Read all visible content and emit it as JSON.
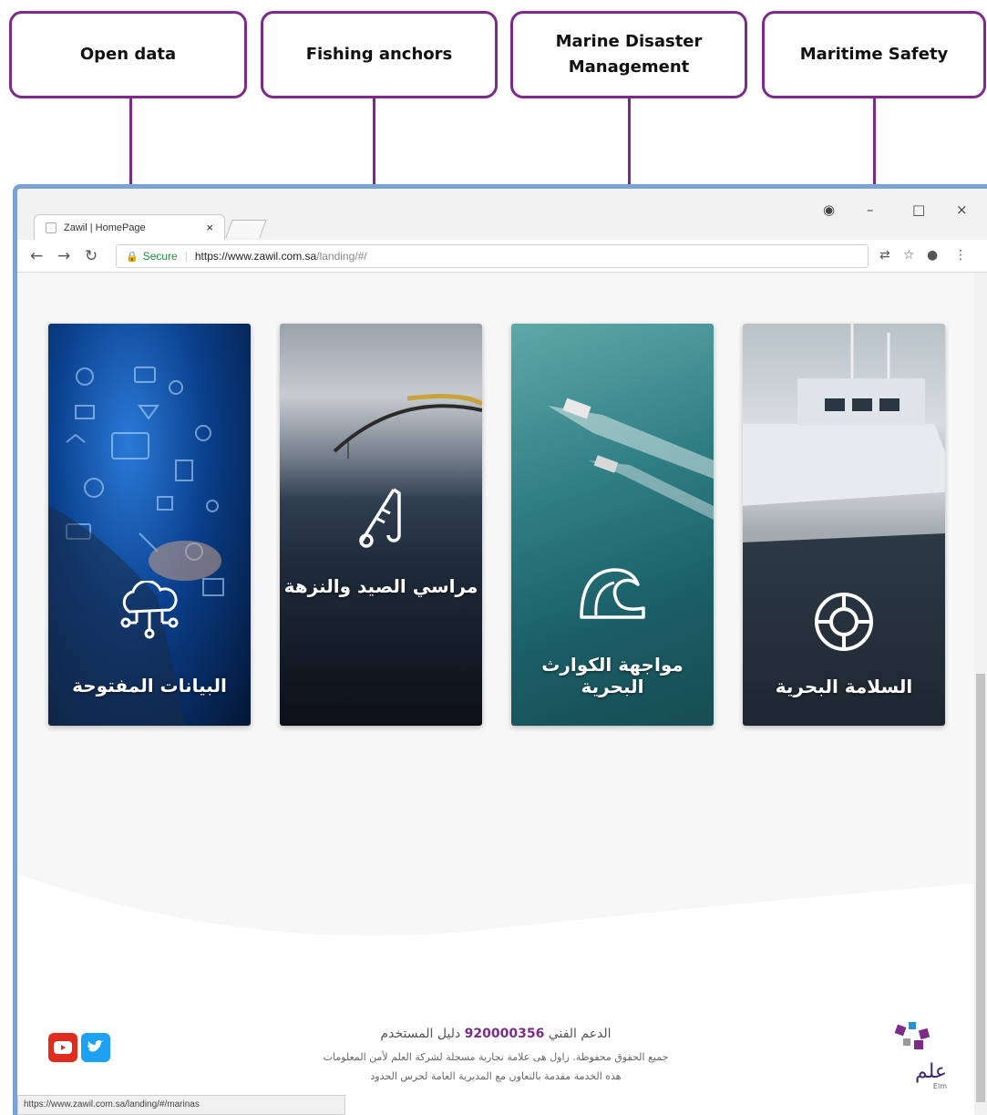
{
  "callouts": {
    "open_data": "Open data",
    "fishing_anchors": "Fishing anchors",
    "marine_disaster": "Marine Disaster Management",
    "maritime_safety": "Maritime Safety"
  },
  "browser": {
    "tab_title": "Zawil | HomePage",
    "secure_label": "Secure",
    "url_host": "https://www.zawil.com.sa",
    "url_path": "/landing/#/",
    "status_url": "https://www.zawil.com.sa/landing/#/marinas"
  },
  "cards": [
    {
      "title": "البيانات المفتوحة",
      "icon": "cloud-network-icon"
    },
    {
      "title": "مراسي الصيد والنزهة",
      "icon": "fishing-rod-icon"
    },
    {
      "title": "مواجهة الكوارث البحرية",
      "icon": "wave-icon"
    },
    {
      "title": "السلامة البحرية",
      "icon": "lifebuoy-icon"
    }
  ],
  "footer": {
    "support_label": "الدعم الفني",
    "support_phone": "920000356",
    "user_guide": "دليل المستخدم",
    "rights": "جميع الحقوق محفوظة. زاول هى علامة تجارية مسجلة لشركة العلم لأمن المعلومات",
    "cooperation": "هذه الخدمة مقدمة بالتعاون مع المديرية العامة لحرس الحدود",
    "logo_text": "علم",
    "logo_sub": "Elm"
  },
  "colors": {
    "callout_border": "#7d2b8b",
    "browser_frame": "#7aa3d4",
    "youtube": "#e02b20",
    "twitter": "#1da1f2"
  }
}
